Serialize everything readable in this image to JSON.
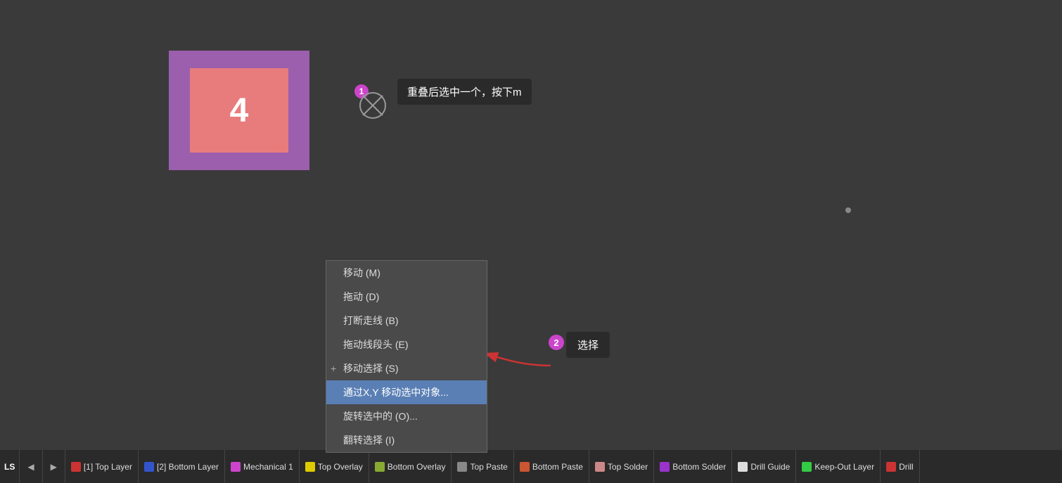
{
  "canvas": {
    "background": "#3a3a3a"
  },
  "pcb": {
    "number": "4",
    "outer_color": "#9b5fad",
    "inner_color": "#e87c7c"
  },
  "tooltip1": {
    "badge": "1",
    "text": "重叠后选中一个，按下m"
  },
  "tooltip2": {
    "badge": "2",
    "text": "选择"
  },
  "context_menu": {
    "items": [
      {
        "label": "移动 (M)",
        "shortcut": "",
        "plus": false,
        "highlighted": false
      },
      {
        "label": "拖动 (D)",
        "shortcut": "",
        "plus": false,
        "highlighted": false
      },
      {
        "label": "打断走线 (B)",
        "shortcut": "",
        "plus": false,
        "highlighted": false
      },
      {
        "label": "拖动线段头 (E)",
        "shortcut": "",
        "plus": false,
        "highlighted": false
      },
      {
        "label": "移动选择 (S)",
        "shortcut": "",
        "plus": true,
        "highlighted": false
      },
      {
        "label": "通过X,Y 移动选中对象...",
        "shortcut": "",
        "plus": false,
        "highlighted": true
      },
      {
        "label": "旋转选中的 (O)...",
        "shortcut": "",
        "plus": false,
        "highlighted": false
      },
      {
        "label": "翻转选择 (I)",
        "shortcut": "",
        "plus": false,
        "highlighted": false
      }
    ]
  },
  "status_bar": {
    "ls_label": "LS",
    "layers": [
      {
        "color": "#cc3333",
        "label": "[1] Top Layer"
      },
      {
        "color": "#3355cc",
        "label": "[2] Bottom Layer"
      },
      {
        "color": "#cc44cc",
        "label": "Mechanical 1"
      },
      {
        "color": "#ddcc00",
        "label": "Top Overlay"
      },
      {
        "color": "#88aa33",
        "label": "Bottom Overlay"
      },
      {
        "color": "#888888",
        "label": "Top Paste"
      },
      {
        "color": "#cc5533",
        "label": "Bottom Paste"
      },
      {
        "color": "#cc8888",
        "label": "Top Solder"
      },
      {
        "color": "#9933cc",
        "label": "Bottom Solder"
      },
      {
        "color": "#dddddd",
        "label": "Drill Guide"
      },
      {
        "color": "#33cc44",
        "label": "Keep-Out Layer"
      },
      {
        "color": "#cc3333",
        "label": "Drill"
      }
    ]
  }
}
